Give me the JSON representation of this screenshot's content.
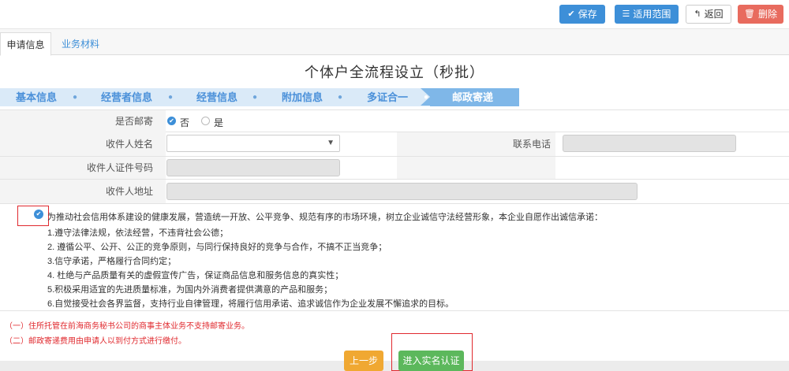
{
  "toolbar": {
    "save_label": "保存",
    "scope_label": "适用范围",
    "back_label": "返回",
    "delete_label": "删除"
  },
  "tabs": [
    {
      "label": "申请信息"
    },
    {
      "label": "业务材料"
    }
  ],
  "page_title": "个体户全流程设立（秒批）",
  "steps": [
    {
      "label": "基本信息"
    },
    {
      "label": "经营者信息"
    },
    {
      "label": "经营信息"
    },
    {
      "label": "附加信息"
    },
    {
      "label": "多证合一"
    },
    {
      "label": "邮政寄递"
    }
  ],
  "form": {
    "mail_label": "是否邮寄",
    "mail_options": [
      "否",
      "是"
    ],
    "mail_selected": "否",
    "recipient_name_label": "收件人姓名",
    "recipient_name_value": "",
    "phone_label": "联系电话",
    "phone_value": "",
    "id_label": "收件人证件号码",
    "id_value": "",
    "address_label": "收件人地址",
    "address_value": ""
  },
  "promise": {
    "checked": true,
    "lines": [
      "为推动社会信用体系建设的健康发展，营造统一开放、公平竞争、规范有序的市场环境，树立企业诚信守法经营形象，本企业自愿作出诚信承诺：",
      "1.遵守法律法规，依法经营，不违背社会公德；",
      "2. 遵循公平、公开、公正的竞争原则，与同行保持良好的竞争与合作，不搞不正当竞争；",
      "3.信守承诺，严格履行合同约定；",
      "4. 杜绝与产品质量有关的虚假宣传广告，保证商品信息和服务信息的真实性；",
      "5.积极采用适宜的先进质量标准，为国内外消费者提供满意的产品和服务；",
      "6.自觉接受社会各界监督，支持行业自律管理，将履行信用承诺、追求诚信作为企业发展不懈追求的目标。"
    ]
  },
  "notes": [
    "（一）住所托管在前海商务秘书公司的商事主体业务不支持邮寄业务。",
    "（二）邮政寄递费用由申请人以到付方式进行缴付。"
  ],
  "footer": {
    "prev_label": "上一步",
    "next_label": "进入实名认证"
  },
  "colors": {
    "primary": "#3d8fd8",
    "danger": "#e86b5e",
    "warning": "#f0a832",
    "success": "#5cb85c",
    "highlight": "#e0292e"
  }
}
